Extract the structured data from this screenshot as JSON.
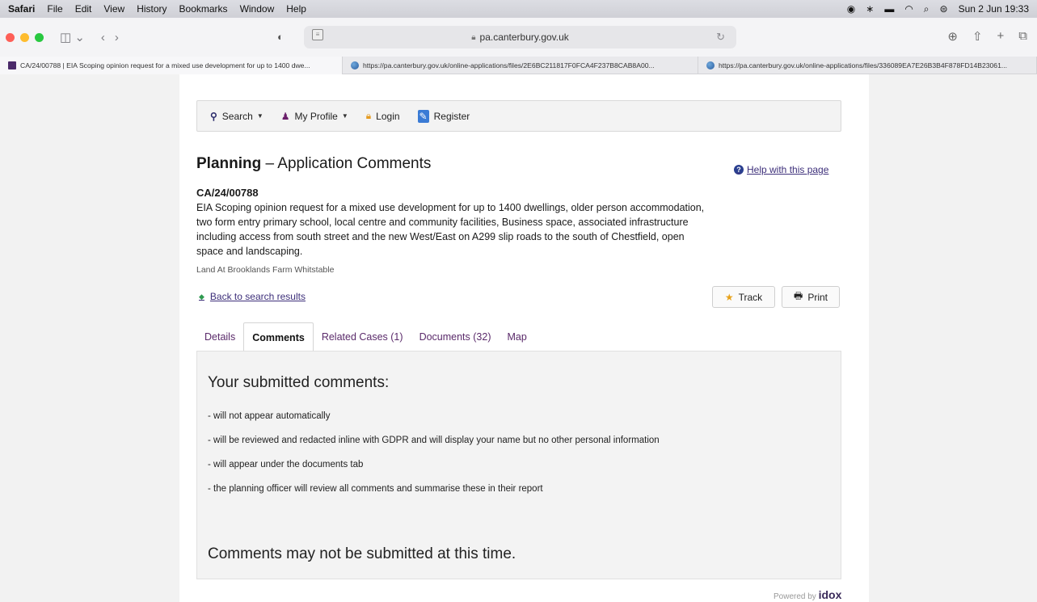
{
  "menubar": {
    "app": "Safari",
    "items": [
      "File",
      "Edit",
      "View",
      "History",
      "Bookmarks",
      "Window",
      "Help"
    ],
    "datetime": "Sun 2 Jun 19:33"
  },
  "browser": {
    "url": "pa.canterbury.gov.uk",
    "tabs": [
      {
        "title": "CA/24/00788 | EIA Scoping opinion request for a mixed use development for up to 1400 dwe..."
      },
      {
        "title": "https://pa.canterbury.gov.uk/online-applications/files/2E6BC211817F0FCA4F237B8CAB8A00..."
      },
      {
        "title": "https://pa.canterbury.gov.uk/online-applications/files/336089EA7E26B3B4F878FD14B23061..."
      }
    ]
  },
  "nav": {
    "search": "Search",
    "profile": "My Profile",
    "login": "Login",
    "register": "Register"
  },
  "page": {
    "title_bold": "Planning",
    "title_rest": " – Application Comments",
    "help": "Help with this page",
    "reference": "CA/24/00788",
    "description": "EIA Scoping opinion request for a mixed use development for up to 1400 dwellings, older person accommodation, two form entry primary school, local centre and community facilities, Business space, associated infrastructure including access from south street and the new West/East on A299 slip roads to the south of Chestfield, open space and landscaping.",
    "address": "Land At Brooklands Farm Whitstable",
    "back": "Back to search results",
    "track": "Track",
    "print": "Print",
    "tabs": [
      "Details",
      "Comments",
      "Related Cases (1)",
      "Documents (32)",
      "Map"
    ]
  },
  "panel": {
    "heading": "Your submitted comments:",
    "bullets": [
      "-  will not appear automatically",
      "-  will be reviewed and redacted inline with GDPR and will display your name but no other personal information",
      "-  will appear under the documents tab",
      "- the planning officer will review all comments and summarise these in their report"
    ],
    "closed": "Comments may not be submitted at this time."
  },
  "footer": {
    "powered": "Powered by",
    "brand": "idox"
  }
}
